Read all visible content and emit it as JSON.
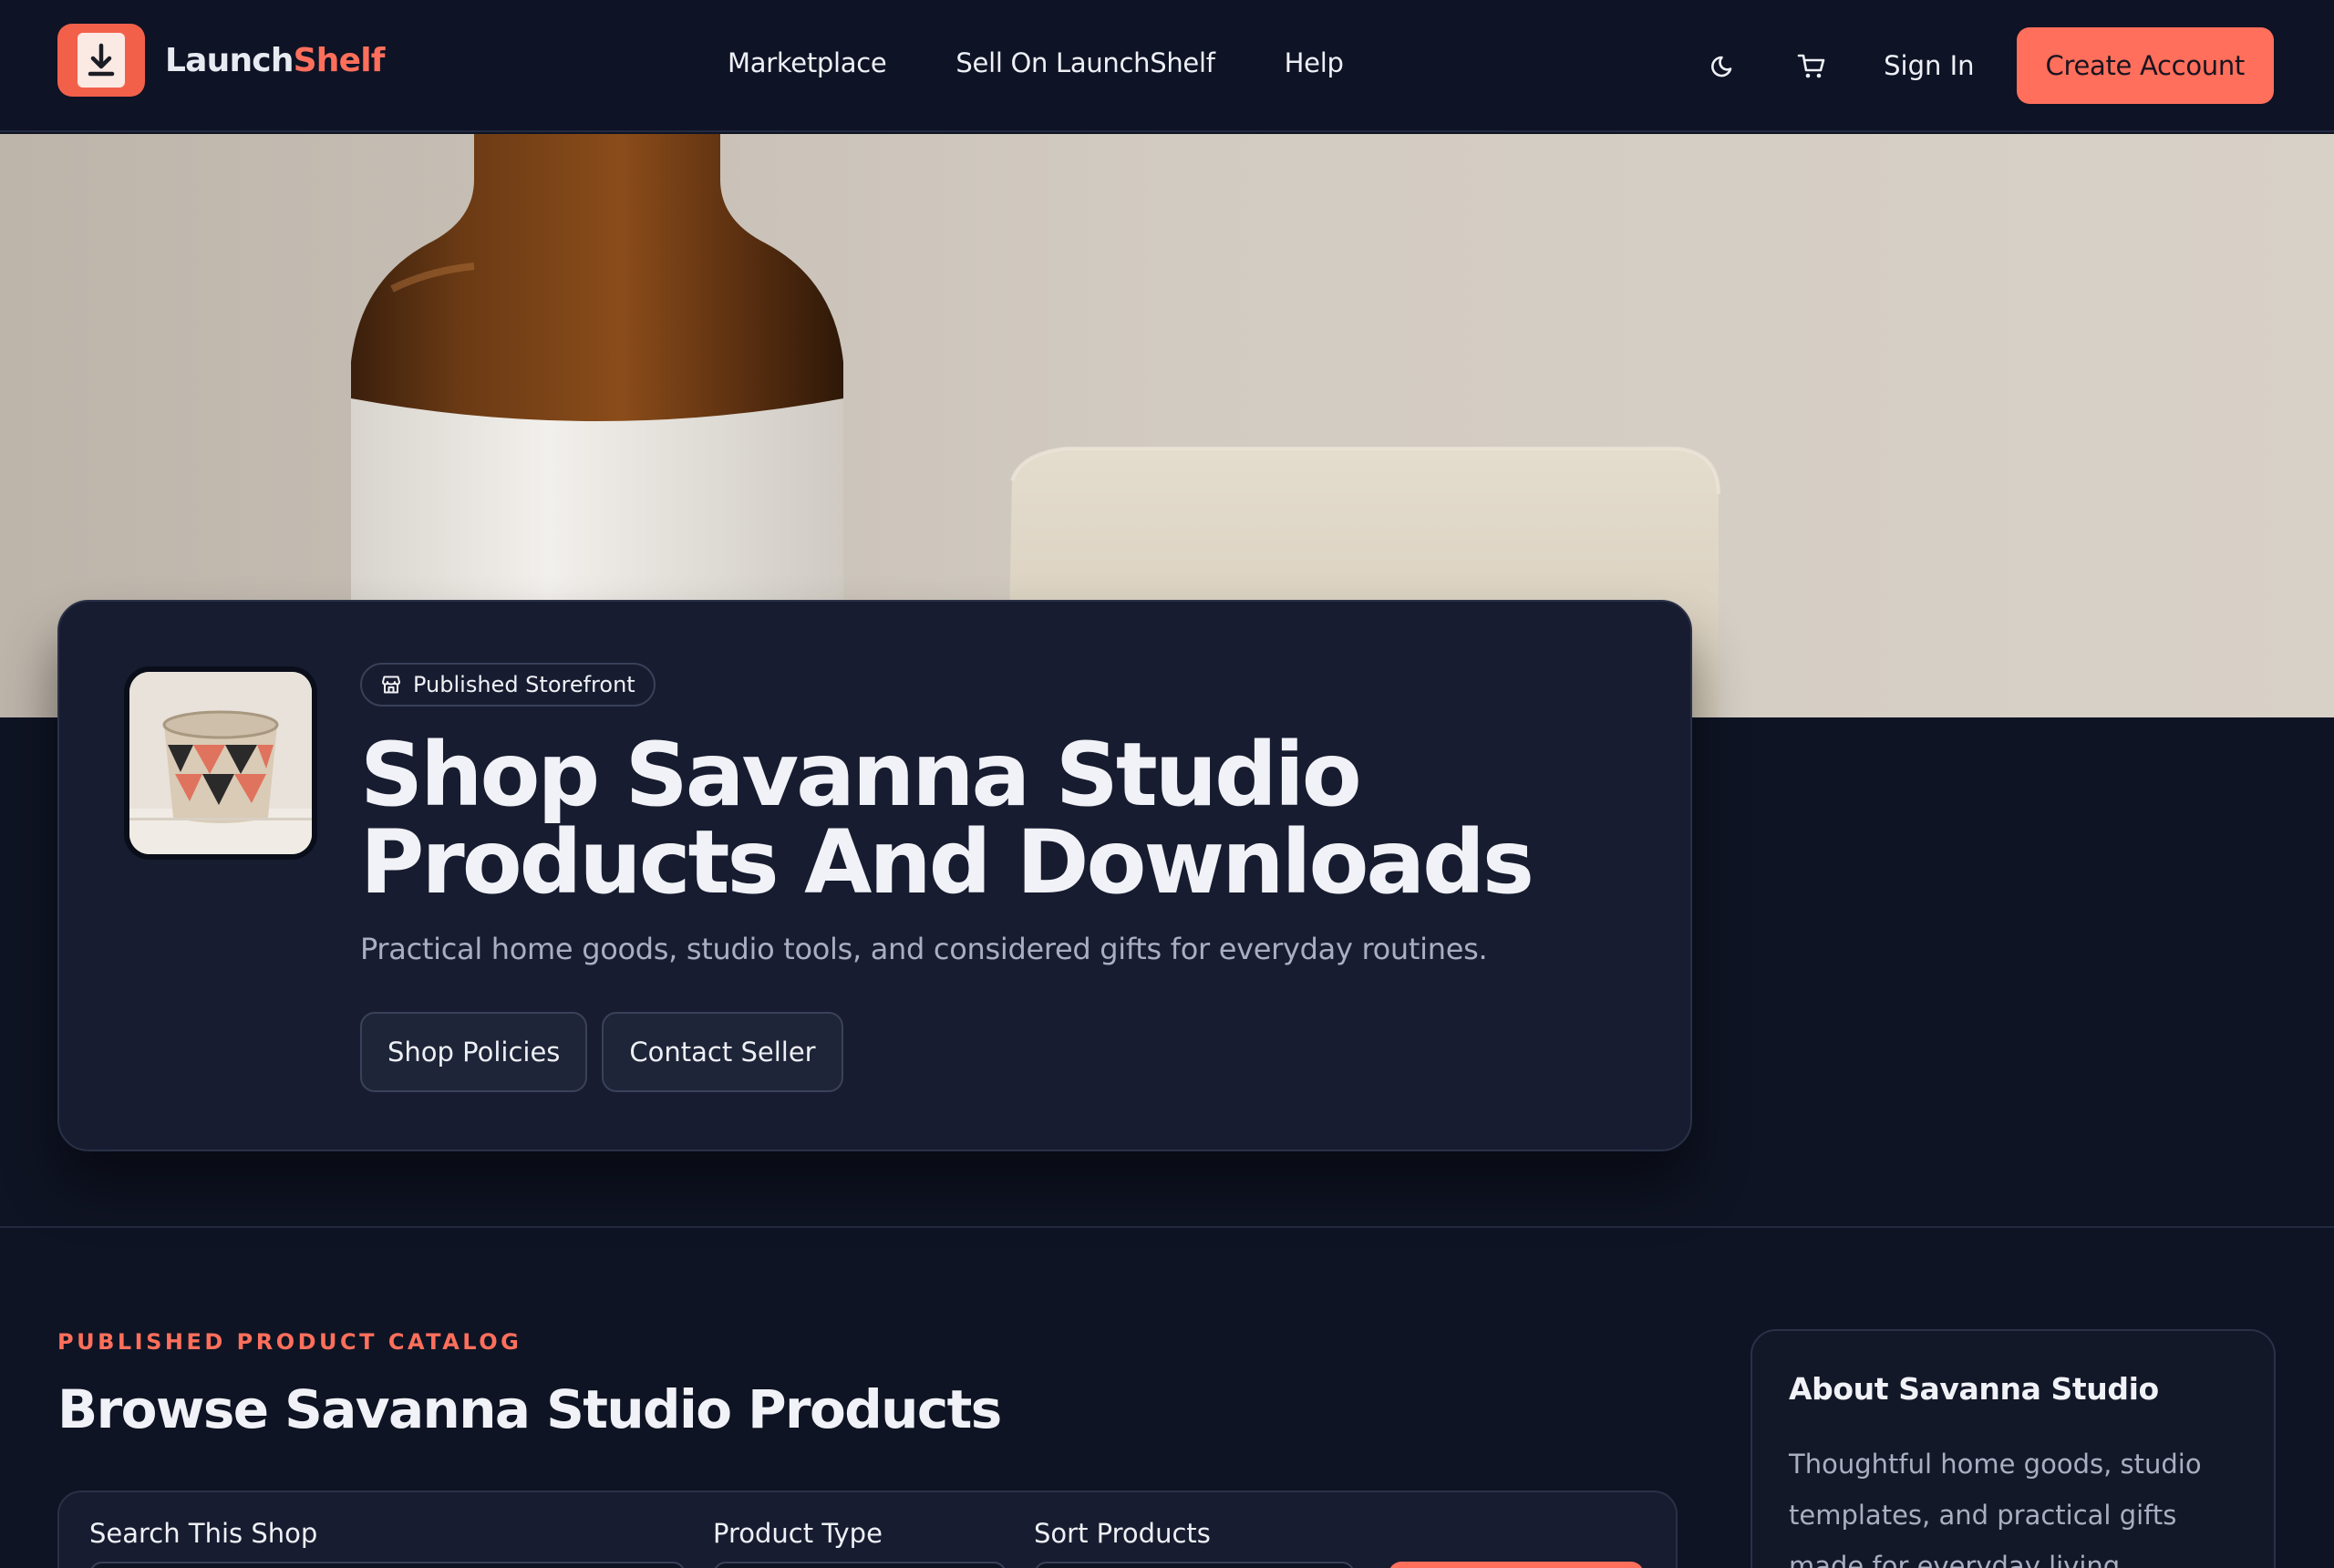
{
  "brand": {
    "name_prefix": "Launch",
    "name_accent": "Shelf",
    "accent_color": "#ff6f5b"
  },
  "nav": {
    "links": [
      "Marketplace",
      "Sell On LaunchShelf",
      "Help"
    ],
    "theme_icon": "moon-icon",
    "cart_icon": "cart-icon",
    "sign_in": "Sign In",
    "create_account": "Create Account"
  },
  "store": {
    "badge": "Published Storefront",
    "badge_icon": "storefront-icon",
    "title": "Shop Savanna Studio Products And Downloads",
    "subtitle": "Practical home goods, studio tools, and considered gifts for everyday routines.",
    "actions": [
      "Shop Policies",
      "Contact Seller"
    ]
  },
  "catalog": {
    "eyebrow": "PUBLISHED PRODUCT CATALOG",
    "title": "Browse Savanna Studio Products",
    "filters": {
      "search_label": "Search This Shop",
      "type_label": "Product Type",
      "sort_label": "Sort Products"
    }
  },
  "about": {
    "title": "About Savanna Studio",
    "text": "Thoughtful home goods, studio templates, and practical gifts made for everyday living."
  }
}
